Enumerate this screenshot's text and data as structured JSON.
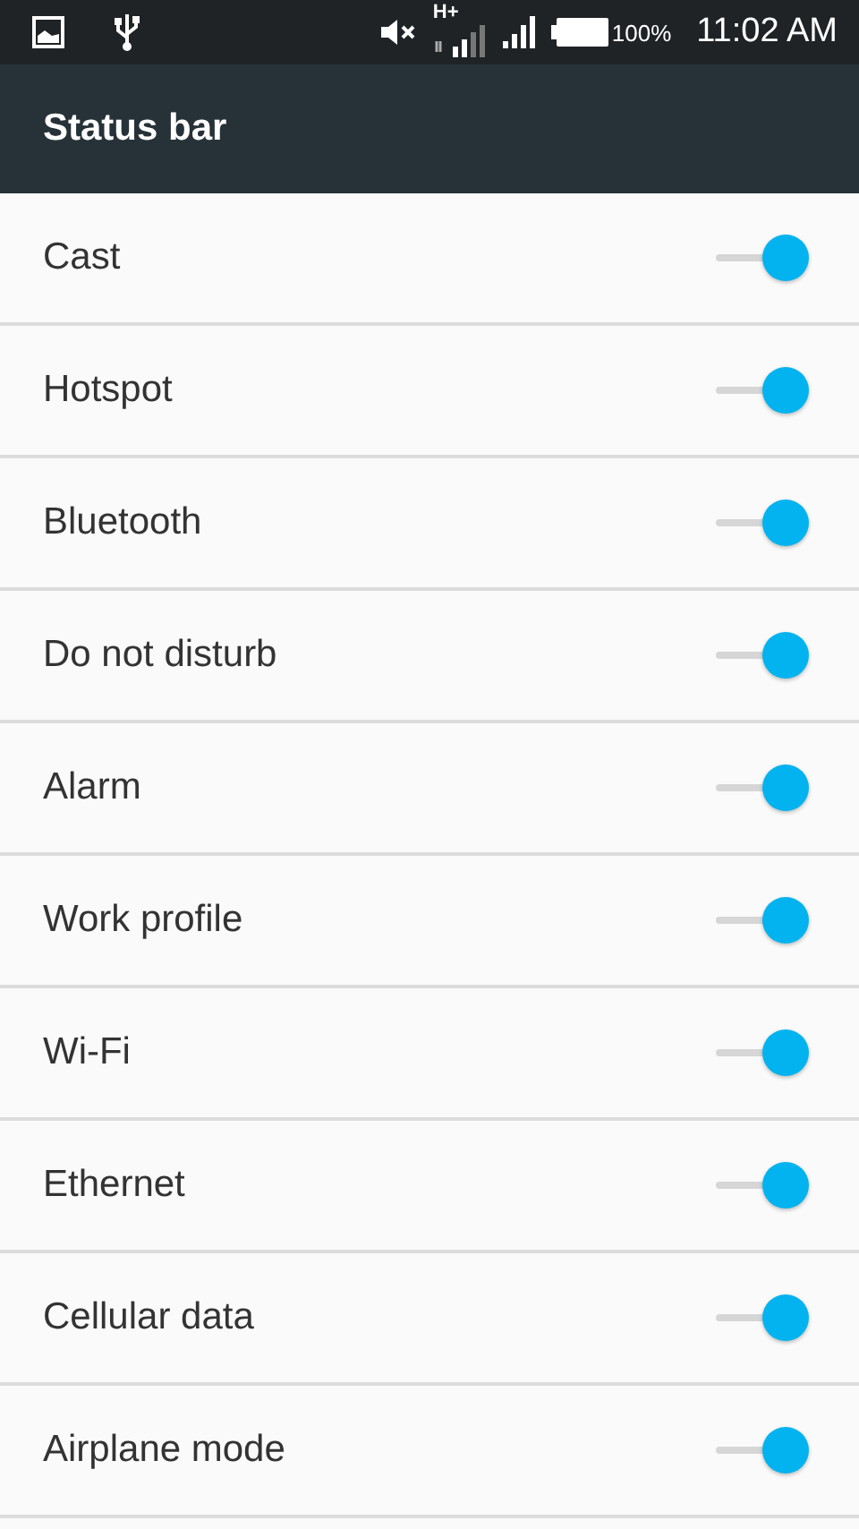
{
  "status_bar": {
    "network_type": "H+",
    "battery": "100%",
    "time": "11:02 AM"
  },
  "toolbar": {
    "title": "Status bar"
  },
  "items": [
    {
      "label": "Cast",
      "on": true
    },
    {
      "label": "Hotspot",
      "on": true
    },
    {
      "label": "Bluetooth",
      "on": true
    },
    {
      "label": "Do not disturb",
      "on": true
    },
    {
      "label": "Alarm",
      "on": true
    },
    {
      "label": "Work profile",
      "on": true
    },
    {
      "label": "Wi-Fi",
      "on": true
    },
    {
      "label": "Ethernet",
      "on": true
    },
    {
      "label": "Cellular data",
      "on": true
    },
    {
      "label": "Airplane mode",
      "on": true
    }
  ]
}
